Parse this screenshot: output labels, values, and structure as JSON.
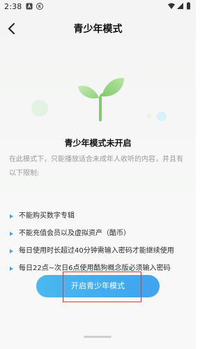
{
  "status_bar": {
    "time": "2:38",
    "notification_icons": [
      "a-app-icon",
      "k-app-icon"
    ],
    "right_icons": [
      "wifi-icon",
      "cellular-signal-icon",
      "battery-icon"
    ]
  },
  "header": {
    "back_icon": "chevron-left-icon",
    "title": "青少年模式"
  },
  "illustration": {
    "name": "sprout-icon",
    "leaf_color": "#8ed07a",
    "stem_color": "#7cc46a"
  },
  "main": {
    "status_title": "青少年模式未开启",
    "description": "在此模式下，只能播放适合未成年人收听的内容，并且有以下限制:",
    "restrictions": [
      {
        "text": "不能购买数字专辑"
      },
      {
        "text": "不能充值会员以及虚拟资产（酷币）"
      },
      {
        "text": "每日使用时长超过40分钟需输入密码才能继续使用"
      },
      {
        "text": "每日22点~次日6点使用酷狗概念版必须输入密码"
      }
    ],
    "bullet_color": "#3fa3ee"
  },
  "enable_button": {
    "label": "开启青少年模式",
    "color": "#45aeee",
    "highlight_color": "#e5323b"
  }
}
